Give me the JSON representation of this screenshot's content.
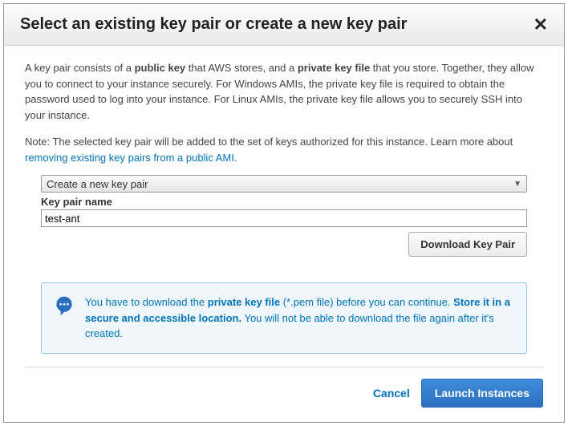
{
  "modal": {
    "title": "Select an existing key pair or create a new key pair",
    "close": "✕"
  },
  "description": {
    "p1_a": "A key pair consists of a ",
    "p1_b": "public key",
    "p1_c": " that AWS stores, and a ",
    "p1_d": "private key file",
    "p1_e": " that you store. Together, they allow you to connect to your instance securely. For Windows AMIs, the private key file is required to obtain the password used to log into your instance. For Linux AMIs, the private key file allows you to securely SSH into your instance.",
    "note_a": "Note: The selected key pair will be added to the set of keys authorized for this instance. Learn more about ",
    "note_link": "removing existing key pairs from a public AMI",
    "note_b": "."
  },
  "form": {
    "dropdown_value": "Create a new key pair",
    "keypair_label": "Key pair name",
    "keypair_value": "test-ant",
    "download_label": "Download Key Pair"
  },
  "info": {
    "t1": "You have to download the ",
    "t2": "private key file",
    "t3": " (*.pem file) before you can continue. ",
    "t4": "Store it in a secure and accessible location.",
    "t5": " You will not be able to download the file again after it's created."
  },
  "footer": {
    "cancel": "Cancel",
    "launch": "Launch Instances"
  }
}
